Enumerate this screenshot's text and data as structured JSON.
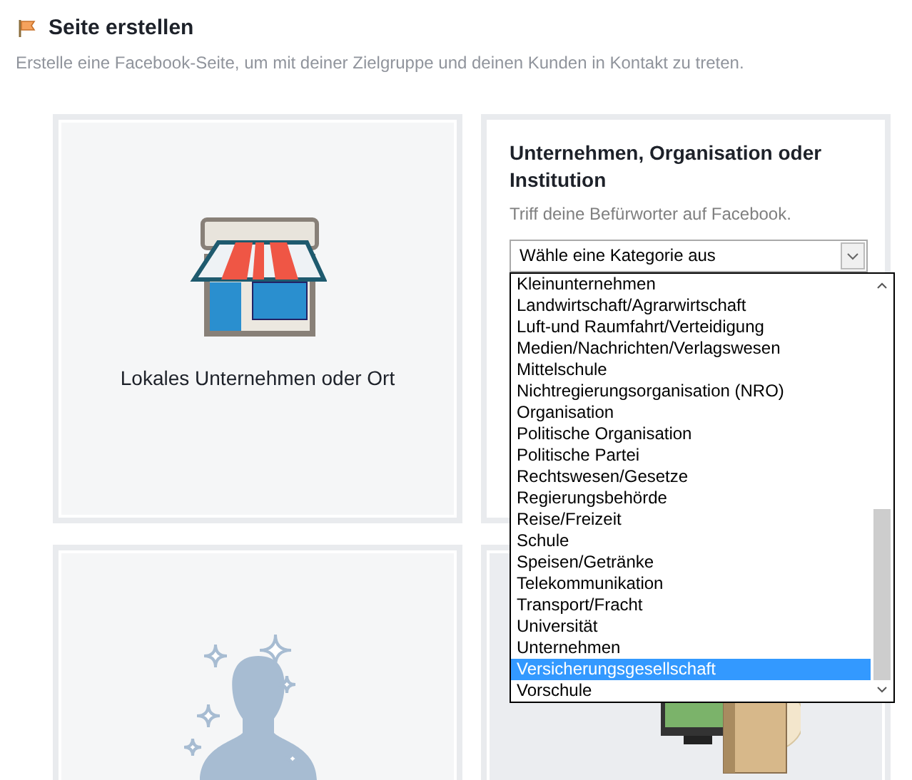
{
  "header": {
    "title": "Seite erstellen",
    "subtitle": "Erstelle eine Facebook-Seite, um mit deiner Zielgruppe und deinen Kunden in Kontakt zu treten."
  },
  "cards": [
    {
      "kind": "local",
      "label": "Lokales Unternehmen oder Ort"
    },
    {
      "kind": "company",
      "title": "Unternehmen, Organisation oder Institution",
      "subtitle": "Triff deine Befürworter auf Facebook.",
      "select": {
        "value": "Wähle eine Kategorie aus",
        "expanded": true,
        "options": [
          {
            "label": "Kleinunternehmen",
            "selected": false
          },
          {
            "label": "Landwirtschaft/Agrarwirtschaft",
            "selected": false
          },
          {
            "label": "Luft-und Raumfahrt/Verteidigung",
            "selected": false
          },
          {
            "label": "Medien/Nachrichten/Verlagswesen",
            "selected": false
          },
          {
            "label": "Mittelschule",
            "selected": false
          },
          {
            "label": "Nichtregierungsorganisation (NRO)",
            "selected": false
          },
          {
            "label": "Organisation",
            "selected": false
          },
          {
            "label": "Politische Organisation",
            "selected": false
          },
          {
            "label": "Politische Partei",
            "selected": false
          },
          {
            "label": "Rechtswesen/Gesetze",
            "selected": false
          },
          {
            "label": "Regierungsbehörde",
            "selected": false
          },
          {
            "label": "Reise/Freizeit",
            "selected": false
          },
          {
            "label": "Schule",
            "selected": false
          },
          {
            "label": "Speisen/Getränke",
            "selected": false
          },
          {
            "label": "Telekommunikation",
            "selected": false
          },
          {
            "label": "Transport/Fracht",
            "selected": false
          },
          {
            "label": "Universität",
            "selected": false
          },
          {
            "label": "Unternehmen",
            "selected": false
          },
          {
            "label": "Versicherungsgesellschaft",
            "selected": true
          },
          {
            "label": "Vorschule",
            "selected": false
          }
        ]
      }
    },
    {
      "kind": "public-figure"
    },
    {
      "kind": "entertainment"
    }
  ]
}
